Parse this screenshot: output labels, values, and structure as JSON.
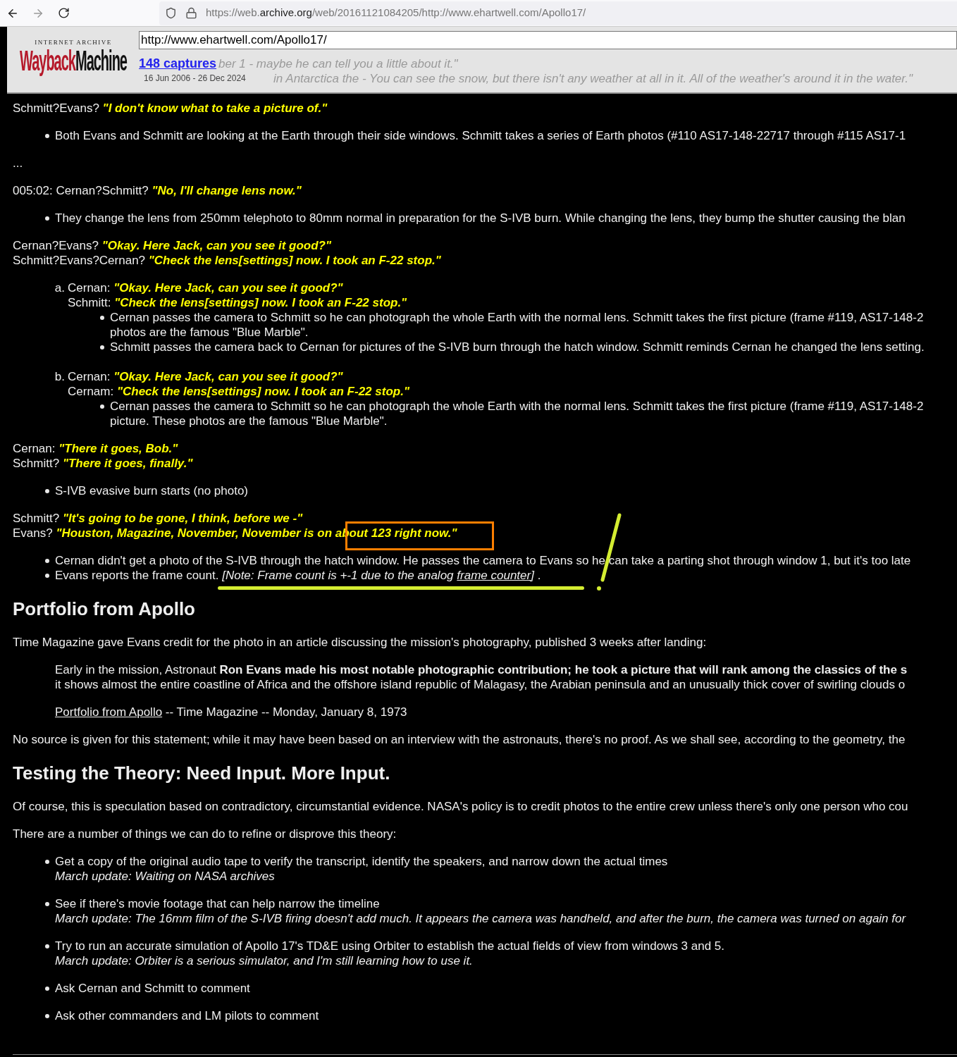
{
  "browser": {
    "url_host": "https://web.",
    "url_domain": "archive.org",
    "url_path": "/web/20161121084205/http://www.ehartwell.com/Apollo17/"
  },
  "wayback": {
    "logo_top": "INTERNET ARCHIVE",
    "logo_red": "Wayback",
    "logo_black": "Machine",
    "url": "http://www.ehartwell.com/Apollo17/",
    "captures": "148 captures",
    "range": "16 Jun 2006 - 26 Dec 2024",
    "behind": [
      "ber 1 - maybe he can tell you a little about it.\"",
      "in Antarctica the - You can see the snow, but there isn't any weather at all in it. All of the weather's around it in the water.\""
    ]
  },
  "blocks": [
    {
      "kind": "dialogue",
      "lines": [
        {
          "speaker": "Schmitt?Evans?",
          "quote": "\"I don't know what to take a picture of.\""
        }
      ]
    },
    {
      "kind": "bullets",
      "items": [
        {
          "lines": [
            "Both Evans and Schmitt are looking at the Earth through their side windows. Schmitt takes a series of Earth photos (#110 AS17-148-22717 through #115 AS17-1"
          ]
        }
      ]
    },
    {
      "kind": "text",
      "lines": [
        "..."
      ]
    },
    {
      "kind": "dialogue",
      "lines": [
        {
          "speaker": "005:02: Cernan?Schmitt?",
          "quote": "\"No, I'll change lens now.\""
        }
      ]
    },
    {
      "kind": "bullets",
      "items": [
        {
          "lines": [
            "They change the lens from 250mm telephoto to 80mm normal in preparation for the S-IVB burn. While changing the lens, they bump the shutter causing the blan"
          ]
        }
      ]
    },
    {
      "kind": "dialogue",
      "lines": [
        {
          "speaker": "Cernan?Evans?",
          "quote": "\"Okay. Here Jack, can you see it good?\""
        },
        {
          "speaker": "Schmitt?Evans?Cernan?",
          "quote": "\"Check the lens[settings] now. I took an F-22 stop.\""
        }
      ]
    },
    {
      "kind": "ordered",
      "items": [
        {
          "label": "a.",
          "lines": [
            {
              "speaker": "Cernan:",
              "quote": "\"Okay. Here Jack, can you see it good?\""
            },
            {
              "speaker": "Schmitt:",
              "quote": "\"Check the lens[settings] now. I took an F-22 stop.\""
            }
          ],
          "bullets": [
            {
              "lines": [
                "Cernan passes the camera to Schmitt so he can photograph the whole Earth with the normal lens. Schmitt takes the first picture (frame #119, AS17-148-2",
                "photos are the famous \"Blue Marble\"."
              ]
            },
            {
              "lines": [
                "Schmitt passes the camera back to Cernan for pictures of the S-IVB burn through the hatch window. Schmitt reminds Cernan he changed the lens setting."
              ]
            }
          ]
        },
        {
          "label": "b.",
          "lines": [
            {
              "speaker": "Cernan:",
              "quote": "\"Okay. Here Jack, can you see it good?\""
            },
            {
              "speaker": "Cernam:",
              "quote": "\"Check the lens[settings] now. I took an F-22 stop.\""
            }
          ],
          "bullets": [
            {
              "lines": [
                "Cernan passes the camera to Schmitt so he can photograph the whole Earth with the normal lens. Schmitt takes the first picture (frame #119, AS17-148-2",
                "picture. These photos are  the famous \"Blue Marble\"."
              ]
            }
          ]
        }
      ]
    },
    {
      "kind": "dialogue",
      "lines": [
        {
          "speaker": "Cernan:",
          "quote": "\"There it goes, Bob.\""
        },
        {
          "speaker": "Schmitt?",
          "quote": "\"There it goes, finally.\""
        }
      ]
    },
    {
      "kind": "bullets",
      "items": [
        {
          "lines": [
            "S-IVB evasive burn starts (no photo)"
          ]
        }
      ]
    },
    {
      "kind": "dialogue",
      "lines": [
        {
          "speaker": "Schmitt?",
          "quote": "\"It's going to be gone, I think, before we -\""
        },
        {
          "speaker": "Evans?",
          "quote": "\"Houston, Magazine, November, November is on about 123 right now.\""
        }
      ]
    },
    {
      "kind": "bullets",
      "items": [
        {
          "lines": [
            "Cernan didn't get a photo of the S-IVB through the hatch window. He passes the camera to Evans so he can take a parting shot through window 1, but it's too late"
          ]
        },
        {
          "lines": [
            "Evans reports the frame count. *[Note: Frame count is +-1 due to the analog*"
          ],
          "link": "frame counter",
          "after": "*]* ."
        }
      ]
    },
    {
      "kind": "heading",
      "lines": [
        "Portfolio from Apollo"
      ]
    },
    {
      "kind": "text",
      "lines": [
        "Time Magazine gave Evans credit for the photo in an article discussing the mission's photography, published 3 weeks after landing:"
      ]
    },
    {
      "kind": "quote",
      "lines": [
        "Early in the mission, Astronaut **Ron Evans made his most notable photographic contribution; he took a picture that will rank among the classics of the s**",
        "it shows almost the entire coastline of Africa and the offshore island republic of Malagasy, the Arabian peninsula and an unusually thick cover of swirling clouds o"
      ],
      "link": "Portfolio from Apollo",
      "after": " -- Time Magazine -- Monday, January 8, 1973"
    },
    {
      "kind": "text",
      "lines": [
        "No source is given for this statement; while it may have been based on an interview with the astronauts, there's no proof. As we shall see, according to the geometry, the"
      ]
    },
    {
      "kind": "heading",
      "lines": [
        "Testing the Theory: Need Input. More Input."
      ]
    },
    {
      "kind": "text",
      "lines": [
        "Of course, this is speculation based on contradictory, circumstantial evidence. NASA's policy is to credit photos to the entire crew unless there's only one person who cou"
      ]
    },
    {
      "kind": "text",
      "lines": [
        "There are a number of things we can do to refine or disprove this theory:"
      ]
    },
    {
      "kind": "bullets",
      "spaced": true,
      "items": [
        {
          "lines": [
            "Get a copy of the original audio tape to verify the transcript, identify the speakers, and narrow down the actual times"
          ],
          "note": "March update: Waiting on NASA archives"
        },
        {
          "lines": [
            "See if there's movie footage that can help narrow the timeline"
          ],
          "note": "March update: The 16mm film of the S-IVB firing doesn't add much. It appears the camera was handheld, and after the burn, the camera was turned on again for"
        },
        {
          "lines": [
            "Try to run an accurate simulation of Apollo 17's TD&E using Orbiter to establish the actual fields of view from windows 3 and 5."
          ],
          "note": "March update: Orbiter is a serious simulator, and I'm still learning how to use it."
        },
        {
          "lines": [
            "Ask Cernan and Schmitt to comment"
          ]
        },
        {
          "lines": [
            "Ask other commanders and LM pilots to comment"
          ]
        }
      ]
    }
  ]
}
